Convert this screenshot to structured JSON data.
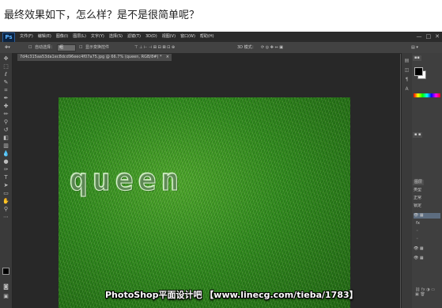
{
  "caption": "最终效果如下，怎么样？是不是很简单呢？",
  "app": {
    "logo": "Ps",
    "menu": [
      "文件(F)",
      "编辑(E)",
      "图像(I)",
      "图层(L)",
      "文字(Y)",
      "选择(S)",
      "滤镜(T)",
      "3D(D)",
      "视图(V)",
      "窗口(W)",
      "帮助(H)"
    ],
    "window_controls": [
      "—",
      "□",
      "✕"
    ]
  },
  "options_bar": {
    "tool_icon": "move-tool-icon",
    "auto_select_label": "自动选择：",
    "auto_select_value": "组",
    "show_transform_label": "显示变换控件",
    "mode_3d_label": "3D 模式："
  },
  "document": {
    "tab_title": "7d4c315aa53da1ec8dcd96eec4f07a75.jpg @ 66.7% (queen, RGB/8#) *",
    "tab_close": "×",
    "canvas_text": "queen"
  },
  "panels": {
    "layers_tab": "图层",
    "filter_label": "类型",
    "blend_label": "正常",
    "lock_label": "锁定"
  },
  "watermark": "PhotoShop平面设计吧 【www.linecg.com/tieba/1783】"
}
